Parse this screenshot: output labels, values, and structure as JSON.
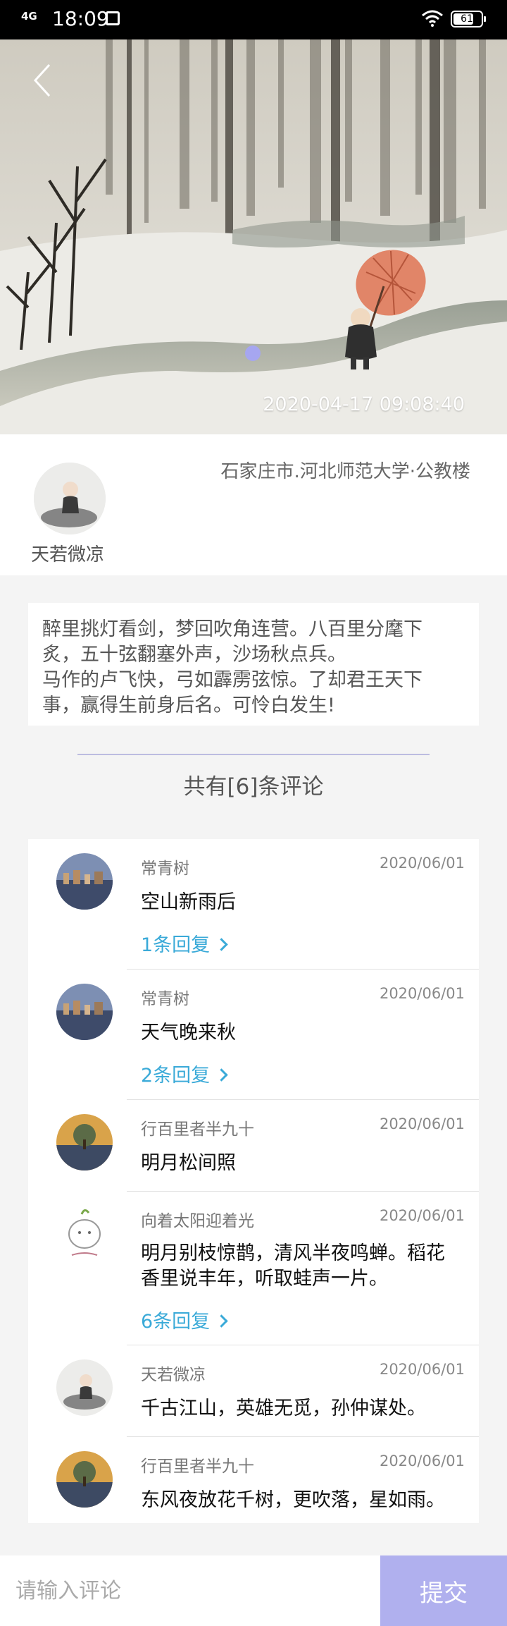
{
  "status_bar": {
    "network": "4G",
    "time": "18:09",
    "battery": "61"
  },
  "hero": {
    "timestamp": "2020-04-17 09:08:40"
  },
  "author": {
    "name": "天若微凉",
    "location": "石家庄市.河北师范大学·公教楼"
  },
  "post": {
    "lines": [
      "醉里挑灯看剑，梦回吹角连营。八百里分麾下",
      "炙，五十弦翻塞外声，沙场秋点兵。",
      "马作的卢飞快，弓如霹雳弦惊。了却君王天下",
      "事，赢得生前身后名。可怜白发生!"
    ]
  },
  "comment_summary": "共有[6]条评论",
  "comments": [
    {
      "user": "常青树",
      "date": "2020/06/01",
      "text": "空山新雨后",
      "reply": "1条回复",
      "avatar": "city-avatar"
    },
    {
      "user": "常青树",
      "date": "2020/06/01",
      "text": "天气晚来秋",
      "reply": "2条回复",
      "avatar": "city-avatar"
    },
    {
      "user": "行百里者半九十",
      "date": "2020/06/01",
      "text": "明月松间照",
      "reply": "",
      "avatar": "tree-avatar"
    },
    {
      "user": "向着太阳迎着光",
      "date": "2020/06/01",
      "text_lines": [
        "明月别枝惊鹊，清风半夜鸣蝉。稻花",
        "香里说丰年，听取蛙声一片。"
      ],
      "reply": "6条回复",
      "avatar": "cartoon-avatar"
    },
    {
      "user": "天若微凉",
      "date": "2020/06/01",
      "text": "千古江山，英雄无觅，孙仲谋处。",
      "reply": "",
      "avatar": "monk-avatar"
    },
    {
      "user": "行百里者半九十",
      "date": "2020/06/01",
      "text": "东风夜放花千树，更吹落，星如雨。",
      "reply": "",
      "avatar": "tree-avatar"
    }
  ],
  "input": {
    "placeholder": "请输入评论",
    "submit_label": "提交"
  },
  "colors": {
    "accent": "#b0b0ee",
    "reply_link": "#3aaad8"
  }
}
